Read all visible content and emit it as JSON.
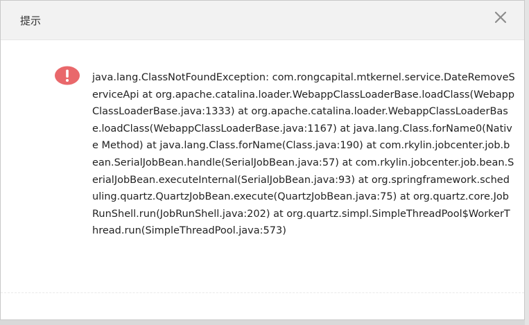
{
  "dialog": {
    "title": "提示",
    "close_icon": "close-icon",
    "alert_icon": "exclamation-circle-icon",
    "accent_color": "#e9686b",
    "message": "java.lang.ClassNotFoundException: com.rongcapital.mtkernel.service.DateRemoveServiceApi at org.apache.catalina.loader.WebappClassLoaderBase.loadClass(WebappClassLoaderBase.java:1333) at org.apache.catalina.loader.WebappClassLoaderBase.loadClass(WebappClassLoaderBase.java:1167) at java.lang.Class.forName0(Native Method) at java.lang.Class.forName(Class.java:190) at com.rkylin.jobcenter.job.bean.SerialJobBean.handle(SerialJobBean.java:57) at com.rkylin.jobcenter.job.bean.SerialJobBean.executeInternal(SerialJobBean.java:93) at org.springframework.scheduling.quartz.QuartzJobBean.execute(QuartzJobBean.java:75) at org.quartz.core.JobRunShell.run(JobRunShell.java:202) at org.quartz.simpl.SimpleThreadPool$WorkerThread.run(SimpleThreadPool.java:573)"
  }
}
